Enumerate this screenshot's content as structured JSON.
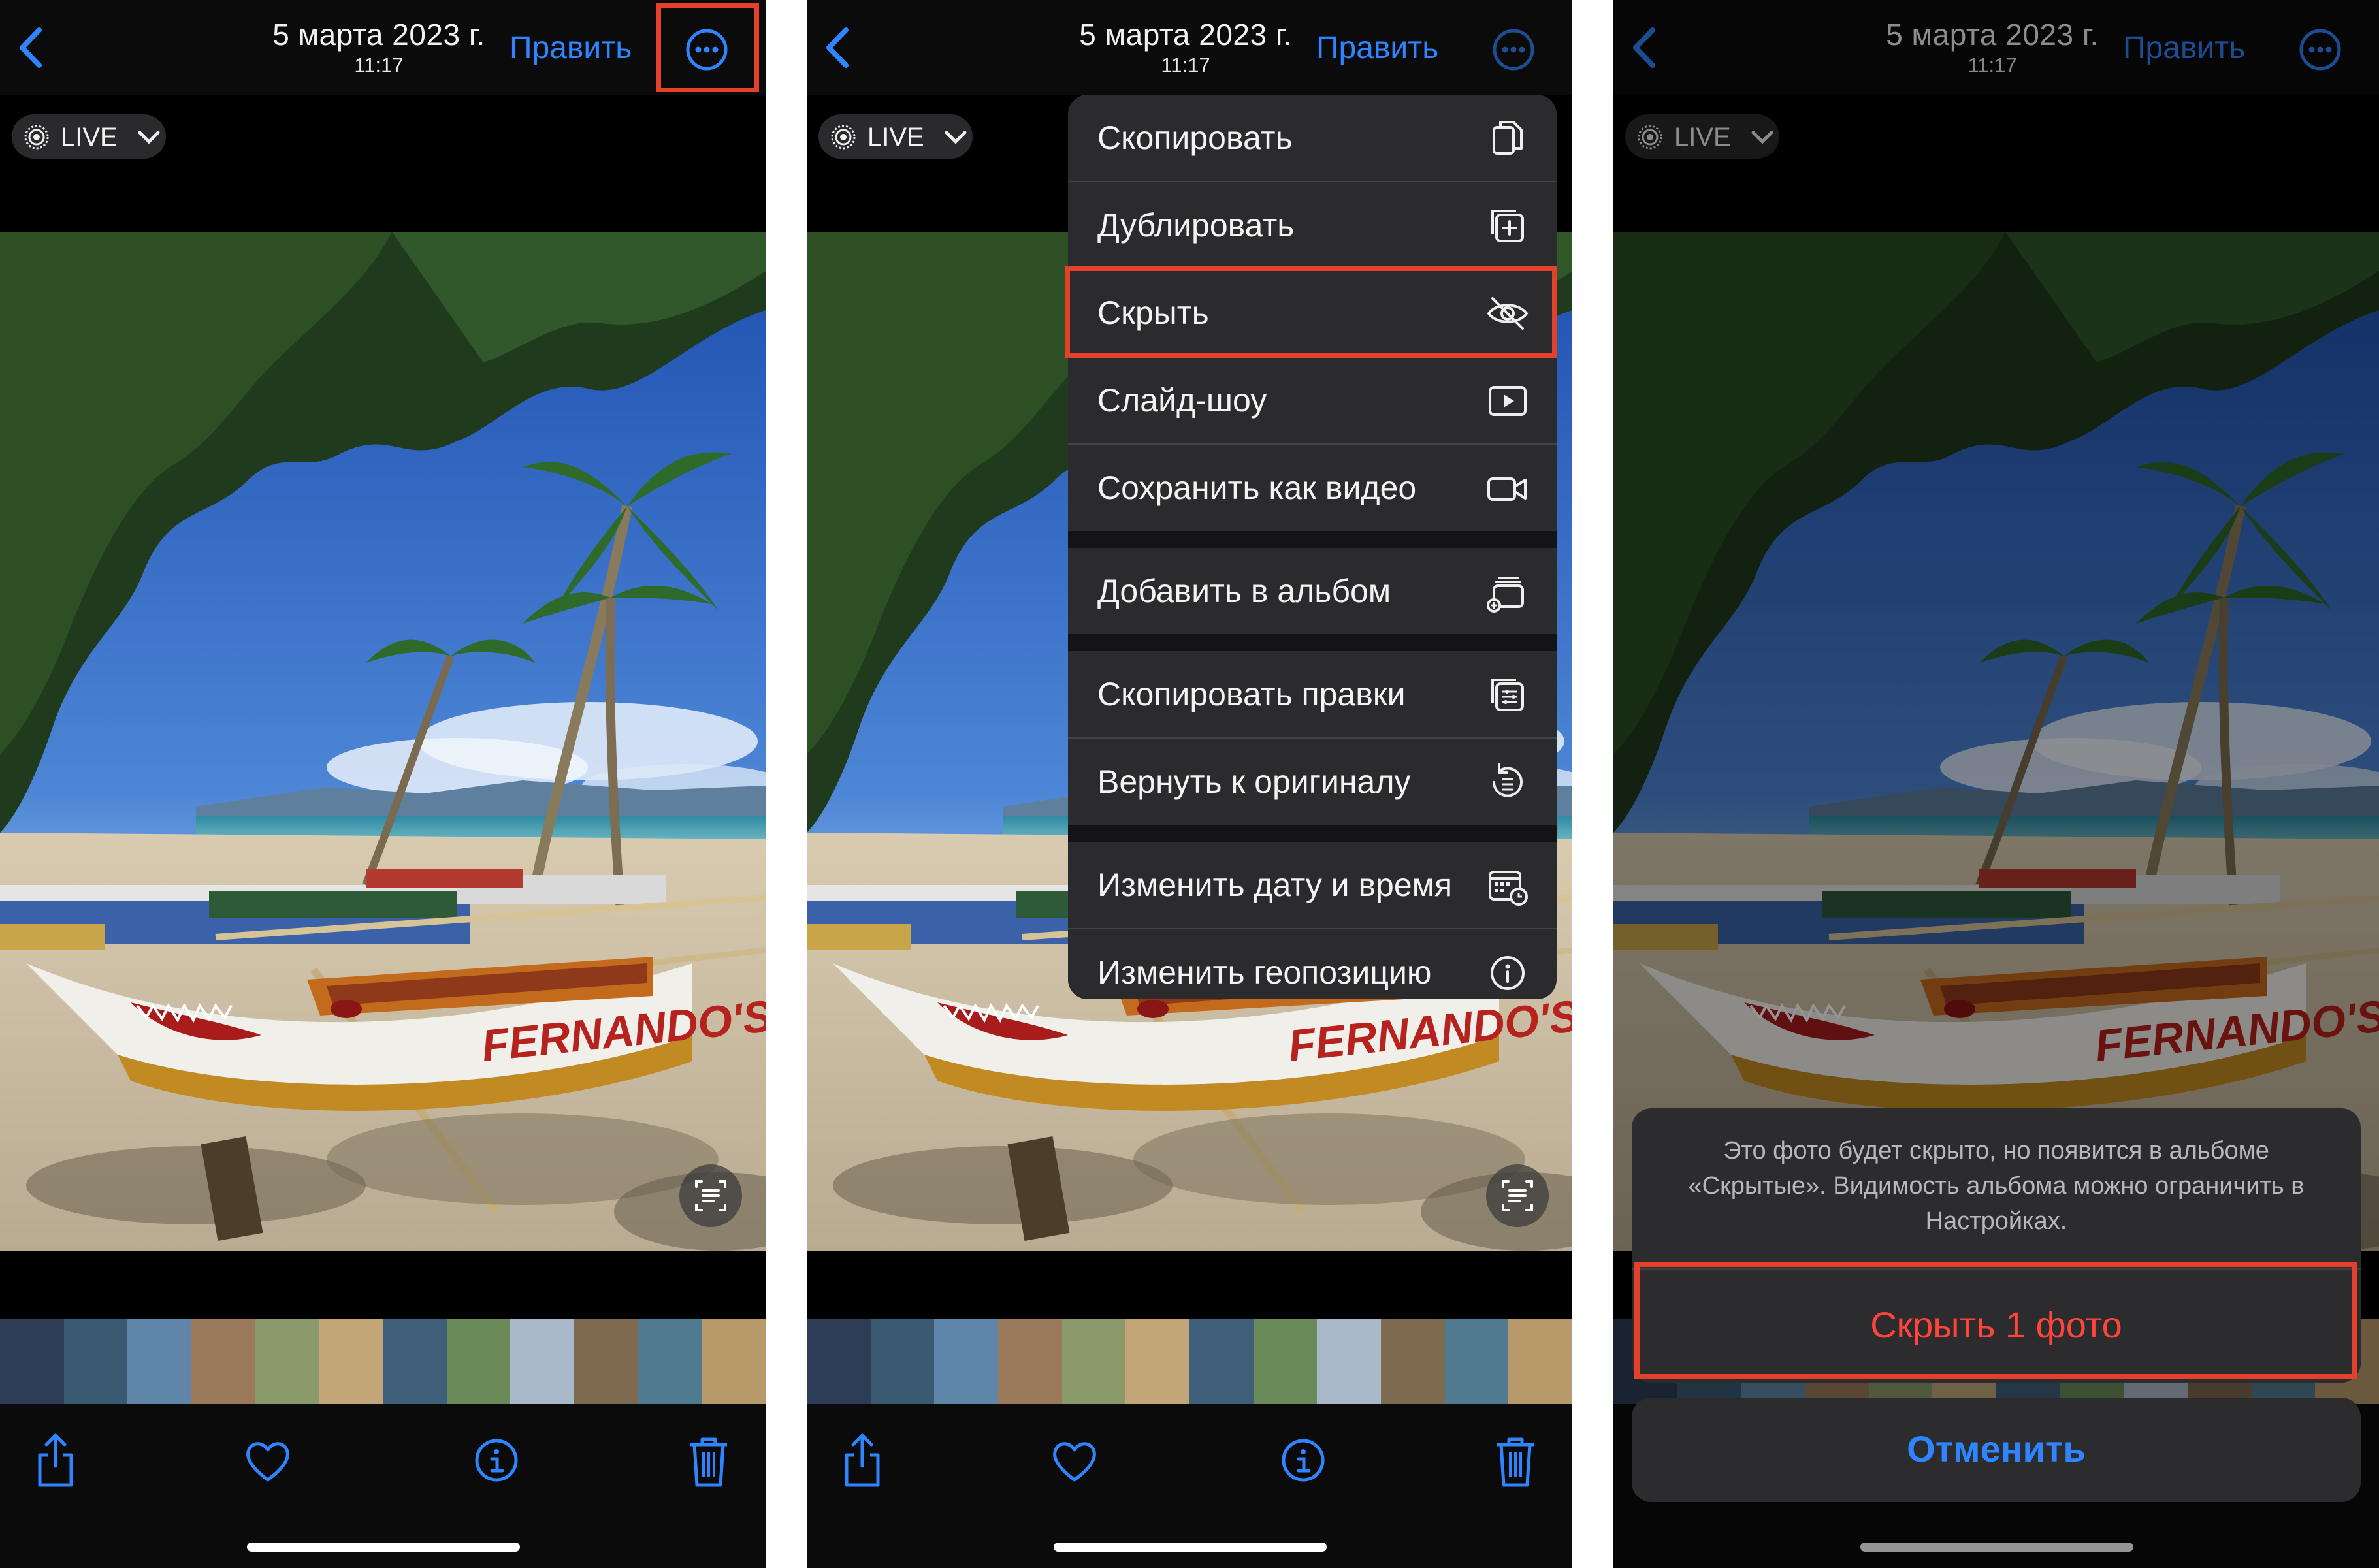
{
  "header": {
    "date": "5 марта 2023 г.",
    "time": "11:17",
    "edit_label": "Править"
  },
  "live_label": "LIVE",
  "photo_text": "FERNANDO'S",
  "menu": {
    "items": [
      {
        "label": "Скопировать",
        "icon": "copy-icon"
      },
      {
        "label": "Дублировать",
        "icon": "duplicate-icon"
      },
      {
        "label": "Скрыть",
        "icon": "eye-slash-icon"
      },
      {
        "label": "Слайд-шоу",
        "icon": "play-icon"
      },
      {
        "label": "Сохранить как видео",
        "icon": "video-icon"
      },
      {
        "label": "Добавить в альбом",
        "icon": "add-to-album-icon"
      },
      {
        "label": "Скопировать правки",
        "icon": "copy-edits-icon"
      },
      {
        "label": "Вернуть к оригиналу",
        "icon": "revert-icon"
      },
      {
        "label": "Изменить дату и время",
        "icon": "calendar-icon"
      },
      {
        "label": "Изменить геопозицию",
        "icon": "info-location-icon"
      }
    ]
  },
  "sheet": {
    "message": "Это фото будет скрыто, но появится в альбоме «Скрытые». Видимость альбома можно ограничить в Настройках.",
    "confirm_label": "Скрыть 1 фото",
    "cancel_label": "Отменить"
  },
  "colors": {
    "accent": "#2f84ff",
    "destructive": "#ff453a",
    "highlight": "#e3412c"
  },
  "toolbar_icons": [
    "share-icon",
    "heart-icon",
    "info-icon",
    "trash-icon"
  ]
}
